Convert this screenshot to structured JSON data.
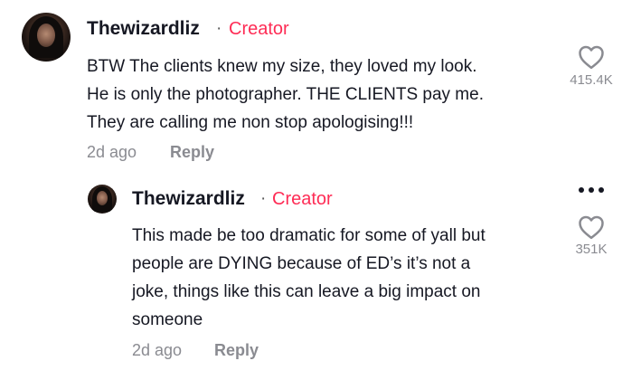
{
  "comment": {
    "username": "Thewizardliz",
    "separator": "·",
    "badge": "Creator",
    "lines": [
      "BTW The clients knew my size, they loved my look.",
      "He is only the photographer. THE CLIENTS pay me.",
      "They are calling me non stop apologising!!!"
    ],
    "time": "2d ago",
    "reply_label": "Reply",
    "likes": "415.4K"
  },
  "reply": {
    "username": "Thewizardliz",
    "separator": "·",
    "badge": "Creator",
    "lines": [
      "This made be too dramatic for some of yall but",
      "people are DYING because of ED’s it’s not a",
      "joke, things like this can leave a big impact on",
      "someone"
    ],
    "time": "2d ago",
    "reply_label": "Reply",
    "likes": "351K"
  },
  "icons": {
    "like": "heart-outline-icon",
    "more": "more-horizontal-icon"
  },
  "colors": {
    "creator_badge": "#fe2c55",
    "meta_text": "#8a8b91",
    "primary_text": "#161823"
  }
}
